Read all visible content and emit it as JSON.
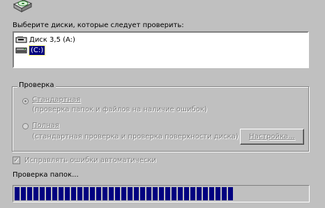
{
  "header": {
    "icon": "disk-check-icon",
    "prompt": "Выберите диски, которые следует проверить:"
  },
  "drives": [
    {
      "icon": "floppy-drive-icon",
      "label": "Диск 3,5 (A:)",
      "selected": false
    },
    {
      "icon": "hard-drive-icon",
      "label": "(C:)",
      "selected": true
    }
  ],
  "check_group": {
    "title": "Проверка",
    "options": [
      {
        "label": "Стандартная",
        "description": "(проверка папок и файлов на наличие ошибок)",
        "selected": true
      },
      {
        "label": "Полная",
        "description": "(стандартная проверка и проверка поверхности диска)",
        "selected": false
      }
    ],
    "settings_button": "Настройка..."
  },
  "auto_fix": {
    "label": "Исправлять ошибки автоматически",
    "checked": true
  },
  "status": {
    "text": "Проверка папок...",
    "progress_fraction": 0.75
  },
  "colors": {
    "face": "#c0c0c0",
    "selection": "#000080",
    "progress": "#000080"
  }
}
